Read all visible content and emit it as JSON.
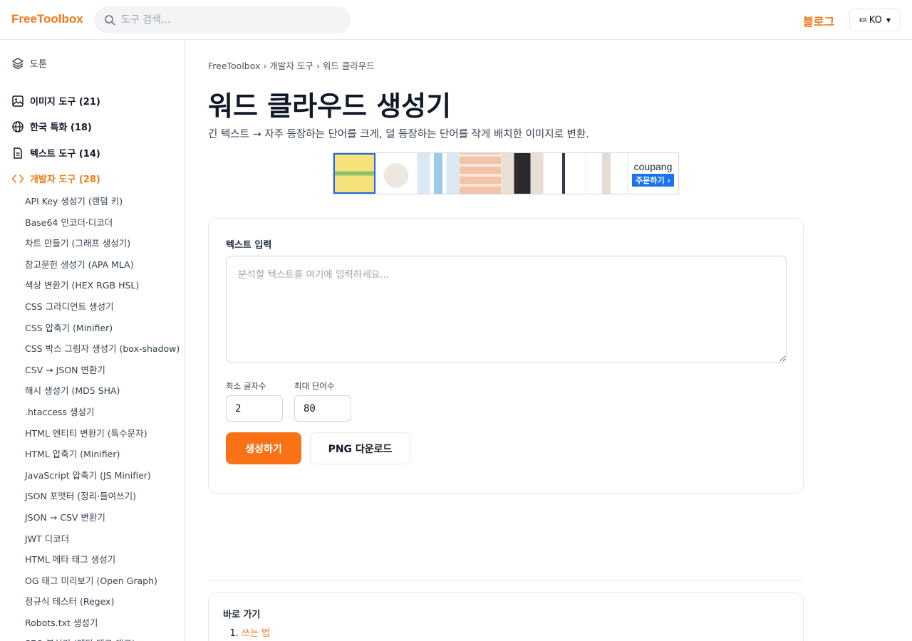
{
  "header": {
    "logo": "FreeToolbox",
    "search_placeholder": "도구 검색...",
    "blog_label": "블로그",
    "lang_flag": "KR",
    "lang_label": "KO"
  },
  "sidebar": {
    "home_label": "도툰",
    "categories": [
      {
        "label": "이미지 도구 (21)",
        "icon": "image-icon"
      },
      {
        "label": "한국 특화 (18)",
        "icon": "globe-icon"
      },
      {
        "label": "텍스트 도구 (14)",
        "icon": "document-icon"
      },
      {
        "label": "개발자 도구 (28)",
        "icon": "code-icon"
      }
    ],
    "dev_tools": [
      "API Key 생성기 (랜덤 키)",
      "Base64 인코더·디코더",
      "차트 만들기 (그래프 생성기)",
      "참고문헌 생성기 (APA MLA)",
      "색상 변환기 (HEX RGB HSL)",
      "CSS 그라디언트 생성기",
      "CSS 압축기 (Minifier)",
      "CSS 박스 그림자 생성기 (box-shadow)",
      "CSV → JSON 변환기",
      "해시 생성기 (MD5 SHA)",
      ".htaccess 생성기",
      "HTML 엔티티 변환기 (특수문자)",
      "HTML 압축기 (Minifier)",
      "JavaScript 압축기 (JS Minifier)",
      "JSON 포맷터 (정리·들여쓰기)",
      "JSON → CSV 변환기",
      "JWT 디코더",
      "HTML 메타 태그 생성기",
      "OG 태그 미리보기 (Open Graph)",
      "정규식 테스터 (Regex)",
      "Robots.txt 생성기",
      "SEO 분석기 (메타 태그 체크)"
    ]
  },
  "breadcrumb": {
    "root": "FreeToolbox",
    "category": "개발자 도구",
    "current": "워드 클라우드",
    "separator": "›"
  },
  "page": {
    "title": "워드 클라우드 생성기",
    "description": "긴 텍스트 → 자주 등장하는 단어를 크게, 덜 등장하는 단어를 작게 배치한 이미지로 변환."
  },
  "ad": {
    "brand": "coupang",
    "cta": "주문하기 ›"
  },
  "form": {
    "text_label": "텍스트 입력",
    "text_placeholder": "분석할 텍스트를 여기에 입력하세요...",
    "min_chars_label": "최소 글자수",
    "min_chars_value": "2",
    "max_words_label": "최대 단어수",
    "max_words_value": "80",
    "generate_label": "생성하기",
    "download_label": "PNG 다운로드"
  },
  "toc": {
    "title": "바로 가기",
    "items": [
      "쓰는 법"
    ]
  },
  "colors": {
    "accent": "#f07a1a",
    "button": "#f97316",
    "ad_blue": "#1a73e8"
  }
}
